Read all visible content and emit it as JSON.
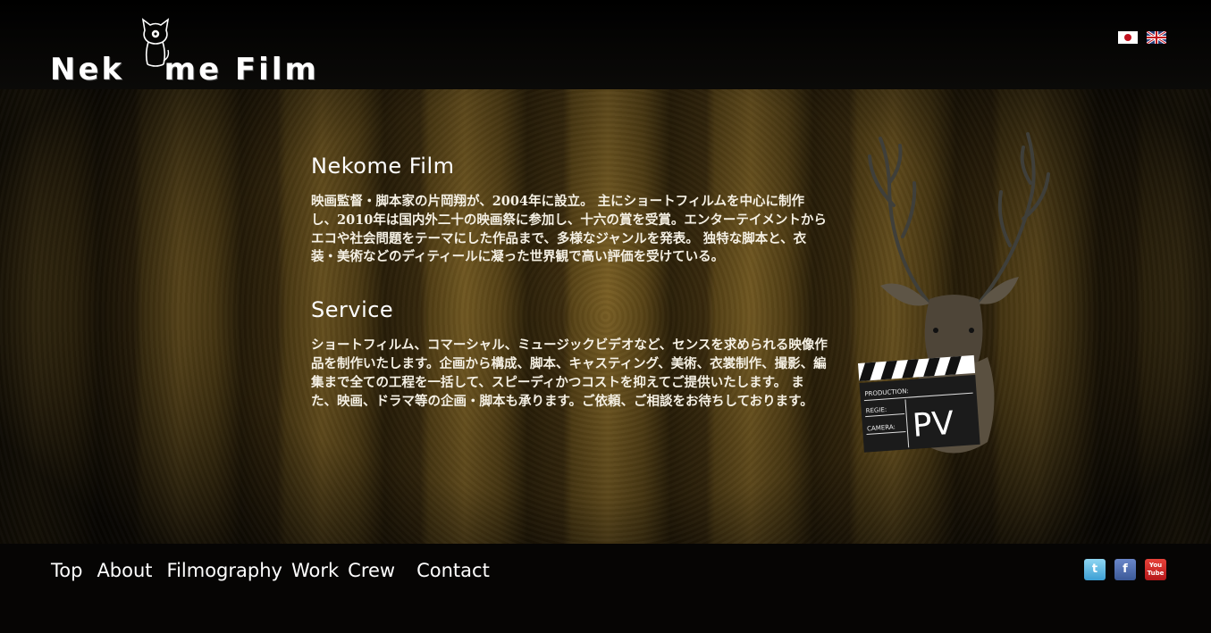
{
  "header": {
    "logo_text": "Nek   me Film",
    "languages": [
      {
        "code": "jp",
        "icon": "japan-flag-icon"
      },
      {
        "code": "en",
        "icon": "uk-flag-icon"
      }
    ]
  },
  "main": {
    "about": {
      "title": "Nekome Film",
      "body": "映画監督・脚本家の片岡翔が、2004年に設立。 主にショートフィルムを中心に制作し、2010年は国内外二十の映画祭に参加し、十六の賞を受賞。エンターテイメントからエコや社会問題をテーマにした作品まで、多様なジャンルを発表。 独特な脚本と、衣装・美術などのディティールに凝った世界観で高い評価を受けている。"
    },
    "service": {
      "title": "Service",
      "body": "ショートフィルム、コマーシャル、ミュージックビデオなど、センスを求められる映像作品を制作いたします。企画から構成、脚本、キャスティング、美術、衣裳制作、撮影、編集まで全ての工程を一括して、スピーディかつコストを抑えてご提供いたします。 また、映画、ドラマ等の企画・脚本も承ります。ご依頼、ご相談をお待ちしております。"
    },
    "clapper": {
      "production": "PRODUCTION:",
      "regie": "REGIE:",
      "camera": "CAMERA:",
      "mark": "PV"
    }
  },
  "footer": {
    "nav": [
      "Top",
      "About",
      "Filmography",
      "Work",
      "Crew",
      "Contact"
    ],
    "social": [
      {
        "icon": "twitter-icon",
        "glyph": "t"
      },
      {
        "icon": "facebook-icon",
        "glyph": "f"
      },
      {
        "icon": "youtube-icon",
        "glyph": "You Tube"
      }
    ]
  },
  "colors": {
    "background": "#050403",
    "wallpaper": "#5a4517",
    "text": "#f4efe2"
  }
}
